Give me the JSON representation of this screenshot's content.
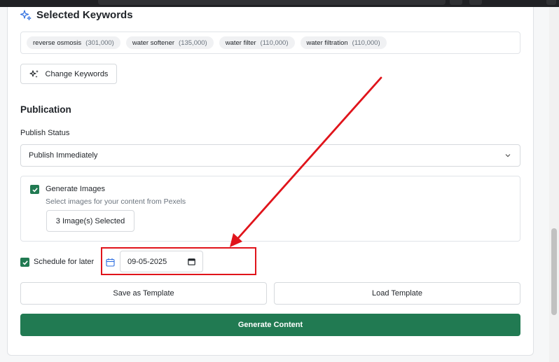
{
  "keywords": {
    "title": "Selected Keywords",
    "items": [
      {
        "term": "reverse osmosis",
        "volume": "(301,000)"
      },
      {
        "term": "water softener",
        "volume": "(135,000)"
      },
      {
        "term": "water filter",
        "volume": "(110,000)"
      },
      {
        "term": "water filtration",
        "volume": "(110,000)"
      }
    ],
    "change_label": "Change Keywords"
  },
  "publication": {
    "title": "Publication",
    "status_label": "Publish Status",
    "status_value": "Publish Immediately",
    "generate_images_label": "Generate Images",
    "generate_images_hint": "Select images for your content from Pexels",
    "images_selected_label": "3 Image(s) Selected",
    "generate_images_checked": true,
    "schedule_label": "Schedule for later",
    "schedule_checked": true,
    "schedule_date": "09-05-2025"
  },
  "actions": {
    "save_template": "Save as Template",
    "load_template": "Load Template",
    "generate": "Generate Content"
  },
  "colors": {
    "accent": "#217a52",
    "annotation": "#e0141b"
  },
  "icons": [
    "sparkle-icon",
    "wand-icon",
    "chevron-down-icon",
    "checkmark-icon",
    "calendar-icon",
    "calendar-picker-icon"
  ]
}
